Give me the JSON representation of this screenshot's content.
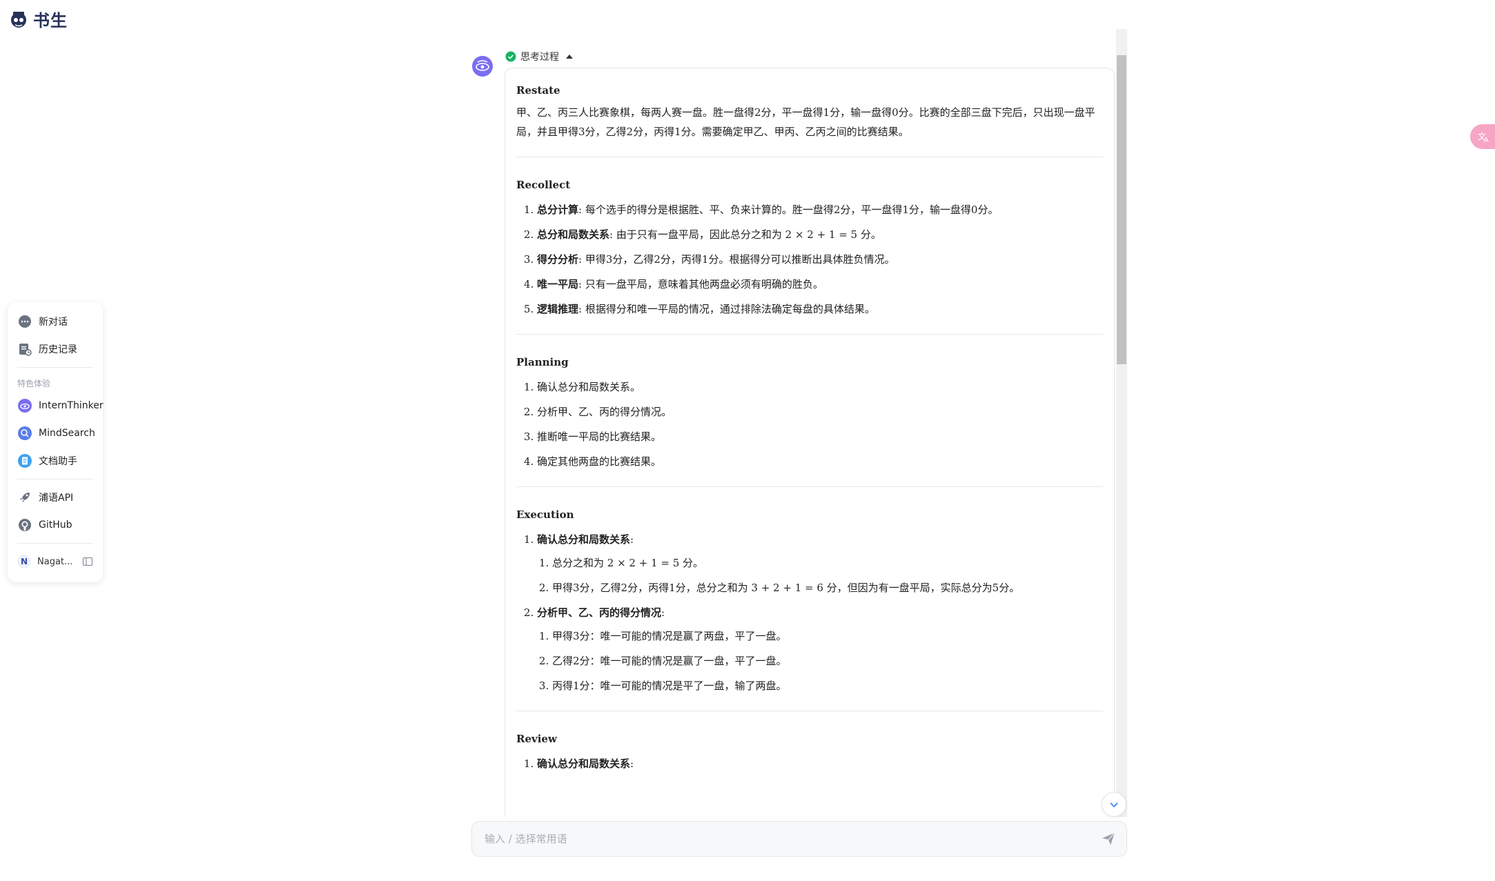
{
  "brand": {
    "name": "书生"
  },
  "nav": {
    "items": [
      {
        "label": "新对话"
      },
      {
        "label": "历史记录"
      }
    ],
    "section_label": "特色体验",
    "features": [
      {
        "label": "InternThinker"
      },
      {
        "label": "MindSearch"
      },
      {
        "label": "文档助手"
      }
    ],
    "links": [
      {
        "label": "浦语API"
      },
      {
        "label": "GitHub"
      }
    ],
    "user": {
      "initial": "N",
      "name": "Nagat..."
    }
  },
  "thinking": {
    "header": "思考过程",
    "restate": {
      "title": "Restate",
      "text": "甲、乙、丙三人比赛象棋，每两人赛一盘。胜一盘得2分，平一盘得1分，输一盘得0分。比赛的全部三盘下完后，只出现一盘平局，并且甲得3分，乙得2分，丙得1分。需要确定甲乙、甲丙、乙丙之间的比赛结果。"
    },
    "recollect": {
      "title": "Recollect",
      "items": [
        {
          "term": "总分计算",
          "text": ": 每个选手的得分是根据胜、平、负来计算的。胜一盘得2分，平一盘得1分，输一盘得0分。"
        },
        {
          "term": "总分和局数关系",
          "text": ": 由于只有一盘平局，因此总分之和为 2 × 2 + 1 = 5 分。"
        },
        {
          "term": "得分分析",
          "text": ": 甲得3分，乙得2分，丙得1分。根据得分可以推断出具体胜负情况。"
        },
        {
          "term": "唯一平局",
          "text": ": 只有一盘平局，意味着其他两盘必须有明确的胜负。"
        },
        {
          "term": "逻辑推理",
          "text": ": 根据得分和唯一平局的情况，通过排除法确定每盘的具体结果。"
        }
      ]
    },
    "planning": {
      "title": "Planning",
      "items": [
        "确认总分和局数关系。",
        "分析甲、乙、丙的得分情况。",
        "推断唯一平局的比赛结果。",
        "确定其他两盘的比赛结果。"
      ]
    },
    "execution": {
      "title": "Execution",
      "steps": [
        {
          "title": "确认总分和局数关系",
          "suffix": ":",
          "sub": [
            "总分之和为 2 × 2 + 1 = 5 分。",
            "甲得3分，乙得2分，丙得1分，总分之和为 3 + 2 + 1 = 6 分，但因为有一盘平局，实际总分为5分。"
          ]
        },
        {
          "title": "分析甲、乙、丙的得分情况",
          "suffix": ":",
          "sub": [
            "甲得3分：唯一可能的情况是赢了两盘，平了一盘。",
            "乙得2分：唯一可能的情况是赢了一盘，平了一盘。",
            "丙得1分：唯一可能的情况是平了一盘，输了两盘。"
          ]
        }
      ]
    },
    "review": {
      "title": "Review",
      "items": [
        {
          "term": "确认总分和局数关系",
          "text": ":"
        }
      ]
    }
  },
  "input": {
    "placeholder": "输入 / 选择常用语"
  },
  "colors": {
    "accent": "#6c63ff",
    "success": "#16b364"
  }
}
